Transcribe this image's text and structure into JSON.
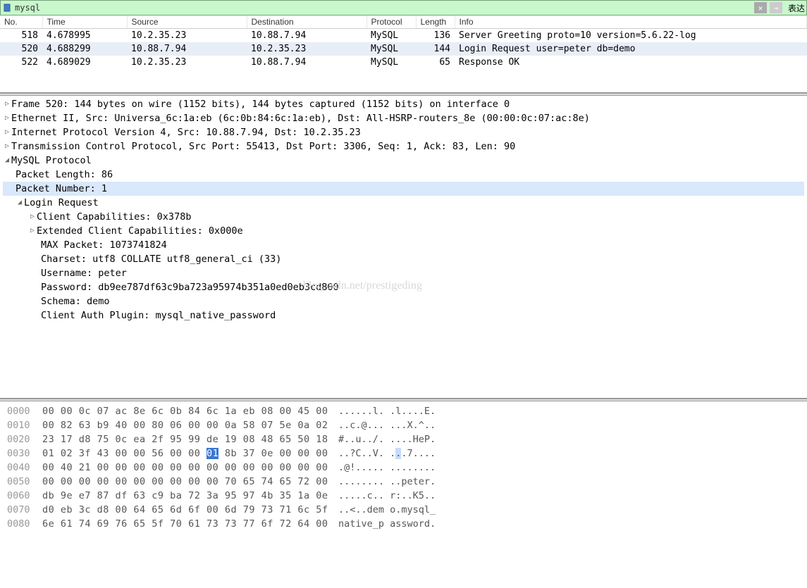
{
  "filter": {
    "value": "mysql",
    "label_right": "表达"
  },
  "columns": {
    "no": "No.",
    "time": "Time",
    "source": "Source",
    "destination": "Destination",
    "protocol": "Protocol",
    "length": "Length",
    "info": "Info"
  },
  "packets": [
    {
      "no": "518",
      "time": "4.678995",
      "src": "10.2.35.23",
      "dst": "10.88.7.94",
      "proto": "MySQL",
      "len": "136",
      "info": "Server Greeting proto=10 version=5.6.22-log"
    },
    {
      "no": "520",
      "time": "4.688299",
      "src": "10.88.7.94",
      "dst": "10.2.35.23",
      "proto": "MySQL",
      "len": "144",
      "info": "Login Request user=peter db=demo"
    },
    {
      "no": "522",
      "time": "4.689029",
      "src": "10.2.35.23",
      "dst": "10.88.7.94",
      "proto": "MySQL",
      "len": "65",
      "info": "Response OK"
    }
  ],
  "selected_index": 1,
  "details": {
    "frame": "Frame 520: 144 bytes on wire (1152 bits), 144 bytes captured (1152 bits) on interface 0",
    "ethernet": "Ethernet II, Src: Universa_6c:1a:eb (6c:0b:84:6c:1a:eb), Dst: All-HSRP-routers_8e (00:00:0c:07:ac:8e)",
    "ip": "Internet Protocol Version 4, Src: 10.88.7.94, Dst: 10.2.35.23",
    "tcp": "Transmission Control Protocol, Src Port: 55413, Dst Port: 3306, Seq: 1, Ack: 83, Len: 90",
    "mysql": {
      "title": "MySQL Protocol",
      "packet_length": "Packet Length: 86",
      "packet_number": "Packet Number: 1",
      "login": {
        "title": "Login Request",
        "client_caps": "Client Capabilities: 0x378b",
        "ext_caps": "Extended Client Capabilities: 0x000e",
        "max_packet": "MAX Packet: 1073741824",
        "charset": "Charset: utf8 COLLATE utf8_general_ci (33)",
        "username": "Username: peter",
        "password": "Password: db9ee787df63c9ba723a95974b351a0ed0eb3cd800",
        "schema": "Schema: demo",
        "auth_plugin": "Client Auth Plugin: mysql_native_password"
      }
    }
  },
  "watermark": "blog.csdn.net/prestigeding",
  "hex": [
    {
      "offset": "0000",
      "bytes": "00 00 0c 07 ac 8e 6c 0b  84 6c 1a eb 08 00 45 00",
      "ascii": "......l. .l....E."
    },
    {
      "offset": "0010",
      "bytes": "00 82 63 b9 40 00 80 06  00 00 0a 58 07 5e 0a 02",
      "ascii": "..c.@... ...X.^.."
    },
    {
      "offset": "0020",
      "bytes": "23 17 d8 75 0c ea 2f 95  99 de 19 08 48 65 50 18",
      "ascii": "#..u../. ....HeP."
    },
    {
      "offset": "0030",
      "bytes_pre": "01 02 3f 43 00 00 56 00  00 ",
      "bytes_sel": "01",
      "bytes_post": " 8b 37 0e 00 00 00",
      "ascii_pre": "..?C..V. .",
      "ascii_sel": ".",
      "ascii_post": ".7...."
    },
    {
      "offset": "0040",
      "bytes": "00 40 21 00 00 00 00 00  00 00 00 00 00 00 00 00",
      "ascii": ".@!..... ........"
    },
    {
      "offset": "0050",
      "bytes": "00 00 00 00 00 00 00 00  00 00 70 65 74 65 72 00",
      "ascii": "........ ..peter."
    },
    {
      "offset": "0060",
      "bytes": "db 9e e7 87 df 63 c9 ba  72 3a 95 97 4b 35 1a 0e",
      "ascii": ".....c.. r:..K5.."
    },
    {
      "offset": "0070",
      "bytes": "d0 eb 3c d8 00 64 65 6d  6f 00 6d 79 73 71 6c 5f",
      "ascii": "..<..dem o.mysql_"
    },
    {
      "offset": "0080",
      "bytes": "6e 61 74 69 76 65 5f 70  61 73 73 77 6f 72 64 00",
      "ascii": "native_p assword."
    }
  ]
}
